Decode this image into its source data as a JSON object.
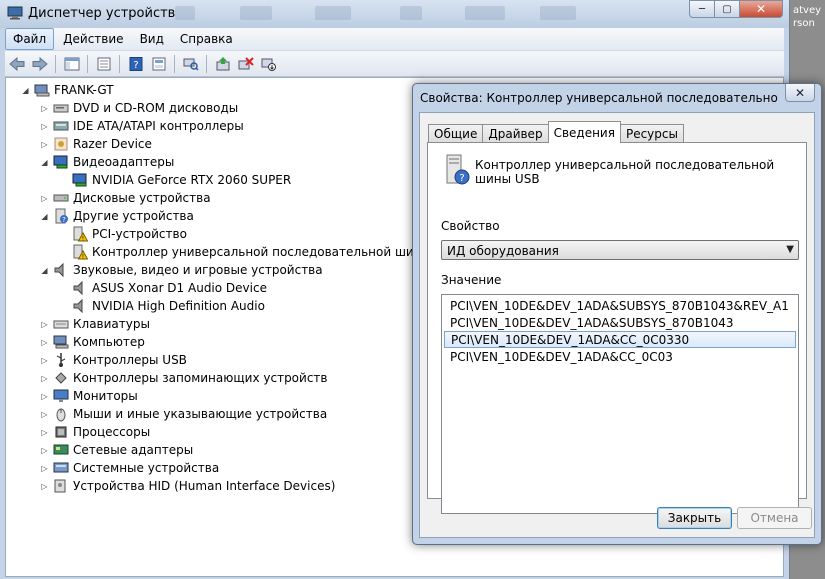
{
  "window": {
    "title": "Диспетчер устройств",
    "min": "─",
    "max": "▢",
    "close": "✕"
  },
  "side_text": [
    "atvey",
    "rson"
  ],
  "menu": [
    "Файл",
    "Действие",
    "Вид",
    "Справка"
  ],
  "tree": {
    "root": "FRANK-GT",
    "items": [
      {
        "label": "DVD и CD-ROM дисководы",
        "icon": "dvd-drive-icon",
        "level": 1,
        "expanded": false
      },
      {
        "label": "IDE ATA/ATAPI контроллеры",
        "icon": "ide-controller-icon",
        "level": 1,
        "expanded": false
      },
      {
        "label": "Razer Device",
        "icon": "razer-device-icon",
        "level": 1,
        "expanded": false
      },
      {
        "label": "Видеоадаптеры",
        "icon": "display-adapter-icon",
        "level": 1,
        "expanded": true
      },
      {
        "label": "NVIDIA GeForce RTX 2060 SUPER",
        "icon": "display-adapter-icon",
        "level": 2
      },
      {
        "label": "Дисковые устройства",
        "icon": "disk-drive-icon",
        "level": 1,
        "expanded": false
      },
      {
        "label": "Другие устройства",
        "icon": "other-devices-icon",
        "level": 1,
        "expanded": true
      },
      {
        "label": "PCI-устройство",
        "icon": "warning-device-icon",
        "level": 2
      },
      {
        "label": "Контроллер универсальной последовательной шины USB",
        "icon": "warning-device-icon",
        "level": 2
      },
      {
        "label": "Звуковые, видео и игровые устройства",
        "icon": "speaker-icon",
        "level": 1,
        "expanded": true
      },
      {
        "label": "ASUS Xonar D1 Audio Device",
        "icon": "speaker-icon",
        "level": 2
      },
      {
        "label": "NVIDIA High Definition Audio",
        "icon": "speaker-icon",
        "level": 2
      },
      {
        "label": "Клавиатуры",
        "icon": "keyboard-icon",
        "level": 1,
        "expanded": false
      },
      {
        "label": "Компьютер",
        "icon": "computer-icon",
        "level": 1,
        "expanded": false
      },
      {
        "label": "Контроллеры USB",
        "icon": "usb-icon",
        "level": 1,
        "expanded": false
      },
      {
        "label": "Контроллеры запоминающих устройств",
        "icon": "storage-controller-icon",
        "level": 1,
        "expanded": false
      },
      {
        "label": "Мониторы",
        "icon": "monitor-icon",
        "level": 1,
        "expanded": false
      },
      {
        "label": "Мыши и иные указывающие устройства",
        "icon": "mouse-icon",
        "level": 1,
        "expanded": false
      },
      {
        "label": "Процессоры",
        "icon": "processor-icon",
        "level": 1,
        "expanded": false
      },
      {
        "label": "Сетевые адаптеры",
        "icon": "network-adapter-icon",
        "level": 1,
        "expanded": false
      },
      {
        "label": "Системные устройства",
        "icon": "system-device-icon",
        "level": 1,
        "expanded": false
      },
      {
        "label": "Устройства HID (Human Interface Devices)",
        "icon": "hid-icon",
        "level": 1,
        "expanded": false
      }
    ]
  },
  "dialog": {
    "title": "Свойства: Контроллер универсальной последовательной шин...",
    "close": "✕",
    "tabs": [
      "Общие",
      "Драйвер",
      "Сведения",
      "Ресурсы"
    ],
    "active_tab": 2,
    "device_name": "Контроллер универсальной последовательной шины USB",
    "property_label": "Свойство",
    "property_value": "ИД оборудования",
    "value_label": "Значение",
    "values": [
      "PCI\\VEN_10DE&DEV_1ADA&SUBSYS_870B1043&REV_A1",
      "PCI\\VEN_10DE&DEV_1ADA&SUBSYS_870B1043",
      "PCI\\VEN_10DE&DEV_1ADA&CC_0C0330",
      "PCI\\VEN_10DE&DEV_1ADA&CC_0C03"
    ],
    "selected_value": 2,
    "ok_label": "Закрыть",
    "cancel_label": "Отмена"
  }
}
